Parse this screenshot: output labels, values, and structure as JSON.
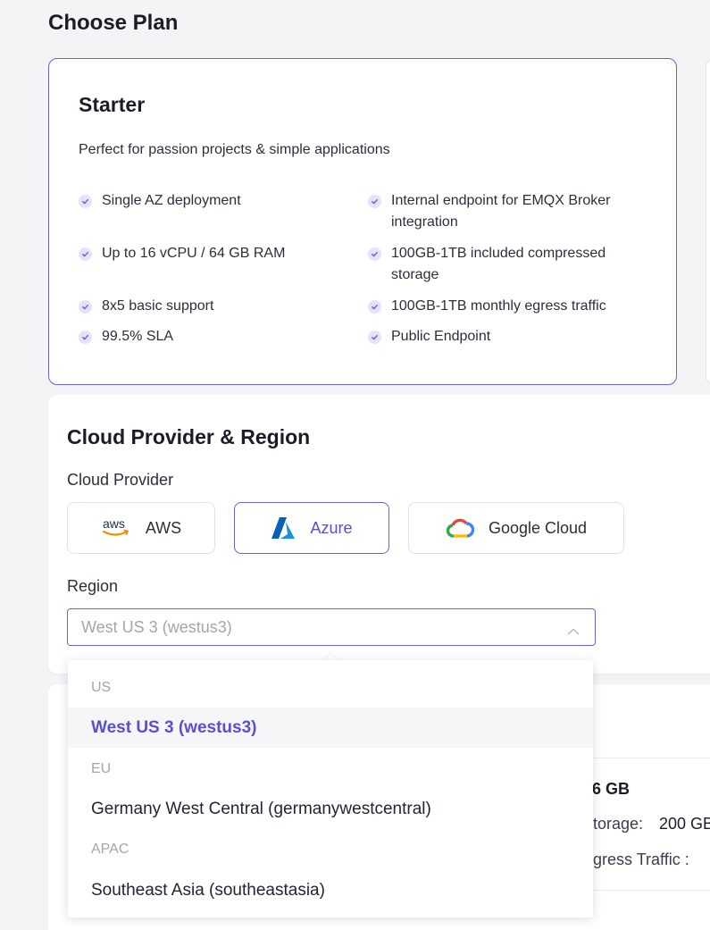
{
  "page_title": "Choose Plan",
  "plan": {
    "name": "Starter",
    "description": "Perfect for passion projects & simple applications",
    "features_left": [
      "Single AZ deployment",
      "Up to 16 vCPU / 64 GB RAM",
      "8x5 basic support",
      "99.5% SLA"
    ],
    "features_right": [
      "Internal endpoint for EMQX Broker integration",
      "100GB-1TB included compressed storage",
      "100GB-1TB monthly egress traffic",
      "Public Endpoint"
    ]
  },
  "cloud": {
    "title": "Cloud Provider & Region",
    "provider_label": "Cloud Provider",
    "providers": [
      "AWS",
      "Azure",
      "Google Cloud"
    ],
    "selected_provider": "Azure",
    "region_label": "Region",
    "region_value": "West US 3 (westus3)"
  },
  "dropdown": {
    "groups": [
      {
        "label": "US",
        "options": [
          "West US 3 (westus3)"
        ]
      },
      {
        "label": "EU",
        "options": [
          "Germany West Central (germanywestcentral)"
        ]
      },
      {
        "label": "APAC",
        "options": [
          "Southeast Asia (southeastasia)"
        ]
      }
    ]
  },
  "background": {
    "memory_fragment": "6 GB",
    "storage_fragment": "torage:",
    "storage_value": "200 GB",
    "egress_fragment": "gress Traffic :"
  },
  "colors": {
    "accent": "#6a5fd6",
    "accent_text": "#5a4fcf",
    "check_bg": "#e6e2fb"
  },
  "icons": {
    "check": "check-circle-icon",
    "chevron": "chevron-up-icon",
    "aws": "aws-logo",
    "azure": "azure-logo",
    "gcp": "google-cloud-logo"
  }
}
